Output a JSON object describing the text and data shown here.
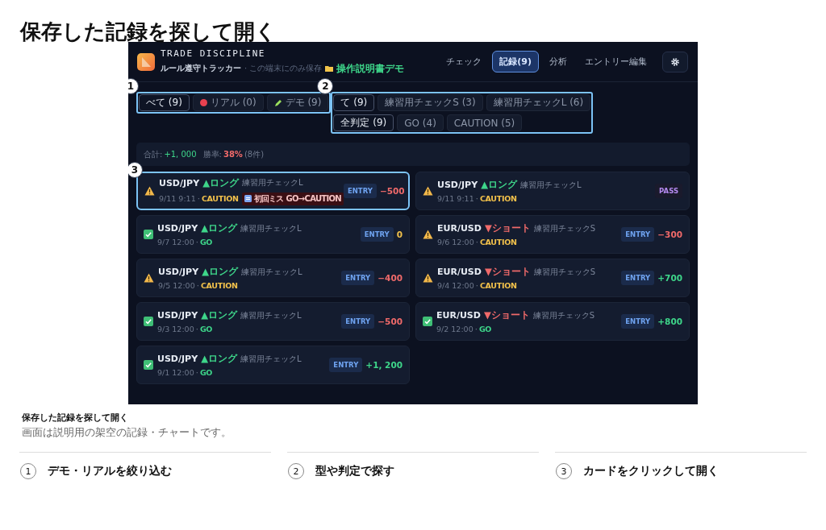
{
  "page": {
    "title": "保存した記録を探して開く"
  },
  "app": {
    "brand": "TRADE DISCIPLINE",
    "subtitle": "ルール遵守トラッカー",
    "storage_note": "· この端末にのみ保存",
    "demo_label": "操作説明書デモ",
    "tabs": [
      {
        "label": "チェック",
        "selected": false
      },
      {
        "label": "記録(9)",
        "selected": true
      },
      {
        "label": "分析",
        "selected": false
      },
      {
        "label": "エントリー編集",
        "selected": false
      }
    ],
    "source_chips": [
      {
        "label": "べて (9)",
        "kind": "all",
        "selected": true
      },
      {
        "label": "リアル (0)",
        "kind": "real",
        "selected": false
      },
      {
        "label": "デモ (9)",
        "kind": "demo",
        "selected": false
      }
    ],
    "type_chips": [
      {
        "label": "て (9)",
        "selected": true
      },
      {
        "label": "練習用チェックS (3)",
        "selected": false
      },
      {
        "label": "練習用チェックL (6)",
        "selected": false
      }
    ],
    "verdict_chips": [
      {
        "label": "全判定 (9)",
        "selected": true
      },
      {
        "label": "GO (4)",
        "selected": false
      },
      {
        "label": "CAUTION (5)",
        "selected": false
      }
    ],
    "summary": {
      "total_label": "合計:",
      "total": "+1, 000",
      "winrate_label": "勝率:",
      "winrate": "38%",
      "count": "(8件)"
    },
    "cards": [
      {
        "pair": "USD/JPY",
        "direction": {
          "kind": "long",
          "label": "▲ロング"
        },
        "check": "練習用チェックL",
        "date": "9/11 9:11",
        "separator": "·",
        "verdict": {
          "kind": "caution",
          "label": "CAUTION"
        },
        "note": "初回ミス GO→CAUTION",
        "action": {
          "kind": "entry",
          "label": "ENTRY"
        },
        "pnl": {
          "value": "−500",
          "color": "#f06a6a"
        },
        "selected": true
      },
      {
        "pair": "USD/JPY",
        "direction": {
          "kind": "long",
          "label": "▲ロング"
        },
        "check": "練習用チェックL",
        "date": "9/11 9:11",
        "separator": "·",
        "verdict": {
          "kind": "caution",
          "label": "CAUTION"
        },
        "action": {
          "kind": "pass",
          "label": "PASS"
        },
        "selected": false
      },
      {
        "pair": "USD/JPY",
        "direction": {
          "kind": "long",
          "label": "▲ロング"
        },
        "check": "練習用チェックL",
        "date": "9/7 12:00",
        "separator": "·",
        "verdict": {
          "kind": "go",
          "label": "GO"
        },
        "action": {
          "kind": "entry",
          "label": "ENTRY"
        },
        "pnl": {
          "value": "0",
          "color": "#f2c14b"
        },
        "selected": false
      },
      {
        "pair": "EUR/USD",
        "direction": {
          "kind": "short",
          "label": "▼ショート"
        },
        "check": "練習用チェックS",
        "date": "9/6 12:00",
        "separator": "·",
        "verdict": {
          "kind": "caution",
          "label": "CAUTION"
        },
        "action": {
          "kind": "entry",
          "label": "ENTRY"
        },
        "pnl": {
          "value": "−300",
          "color": "#f06a6a"
        },
        "selected": false
      },
      {
        "pair": "USD/JPY",
        "direction": {
          "kind": "long",
          "label": "▲ロング"
        },
        "check": "練習用チェックL",
        "date": "9/5 12:00",
        "separator": "·",
        "verdict": {
          "kind": "caution",
          "label": "CAUTION"
        },
        "action": {
          "kind": "entry",
          "label": "ENTRY"
        },
        "pnl": {
          "value": "−400",
          "color": "#f06a6a"
        },
        "selected": false
      },
      {
        "pair": "EUR/USD",
        "direction": {
          "kind": "short",
          "label": "▼ショート"
        },
        "check": "練習用チェックS",
        "date": "9/4 12:00",
        "separator": "·",
        "verdict": {
          "kind": "caution",
          "label": "CAUTION"
        },
        "action": {
          "kind": "entry",
          "label": "ENTRY"
        },
        "pnl": {
          "value": "+700",
          "color": "#3ed68a"
        },
        "selected": false
      },
      {
        "pair": "USD/JPY",
        "direction": {
          "kind": "long",
          "label": "▲ロング"
        },
        "check": "練習用チェックL",
        "date": "9/3 12:00",
        "separator": "·",
        "verdict": {
          "kind": "go",
          "label": "GO"
        },
        "action": {
          "kind": "entry",
          "label": "ENTRY"
        },
        "pnl": {
          "value": "−500",
          "color": "#f06a6a"
        },
        "selected": false
      },
      {
        "pair": "EUR/USD",
        "direction": {
          "kind": "short",
          "label": "▼ショート"
        },
        "check": "練習用チェックS",
        "date": "9/2 12:00",
        "separator": "·",
        "verdict": {
          "kind": "go",
          "label": "GO"
        },
        "action": {
          "kind": "entry",
          "label": "ENTRY"
        },
        "pnl": {
          "value": "+800",
          "color": "#3ed68a"
        },
        "selected": false
      },
      {
        "pair": "USD/JPY",
        "direction": {
          "kind": "long",
          "label": "▲ロング"
        },
        "check": "練習用チェックL",
        "date": "9/1 12:00",
        "separator": "·",
        "verdict": {
          "kind": "go",
          "label": "GO"
        },
        "action": {
          "kind": "entry",
          "label": "ENTRY"
        },
        "pnl": {
          "value": "+1, 200",
          "color": "#3ed68a"
        },
        "selected": false
      }
    ],
    "callouts": [
      "1",
      "2",
      "3"
    ]
  },
  "caption": {
    "title": "保存した記録を探して開く",
    "text": "画面は説明用の架空の記録・チャートです。"
  },
  "steps": [
    {
      "number": "1",
      "text": "デモ・リアルを絞り込む"
    },
    {
      "number": "2",
      "text": "型や判定で探す"
    },
    {
      "number": "3",
      "text": "カードをクリックして開く"
    }
  ]
}
